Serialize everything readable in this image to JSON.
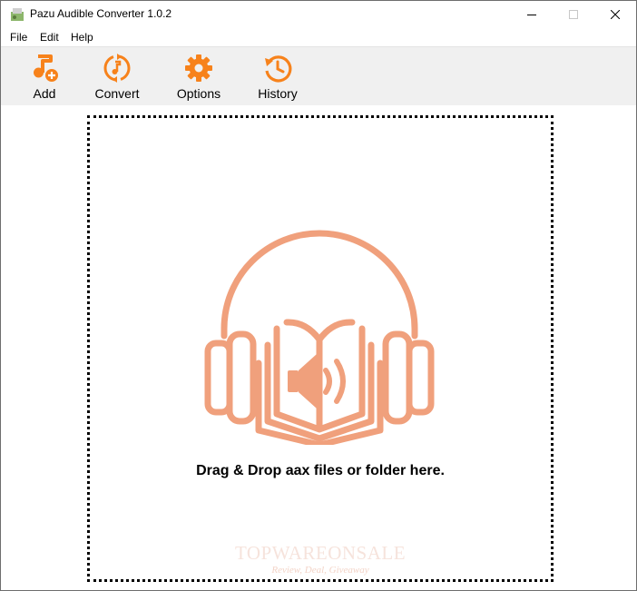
{
  "window": {
    "title": "Pazu Audible Converter 1.0.2"
  },
  "menu": {
    "file": "File",
    "edit": "Edit",
    "help": "Help"
  },
  "toolbar": {
    "add": "Add",
    "convert": "Convert",
    "options": "Options",
    "history": "History"
  },
  "drop": {
    "text": "Drag & Drop aax files or folder here."
  },
  "watermark": {
    "title": "TOPWAREONSALE",
    "subtitle": "Review, Deal, Giveaway"
  },
  "colors": {
    "accent": "#f7821b",
    "illustration": "#f0a07c"
  }
}
